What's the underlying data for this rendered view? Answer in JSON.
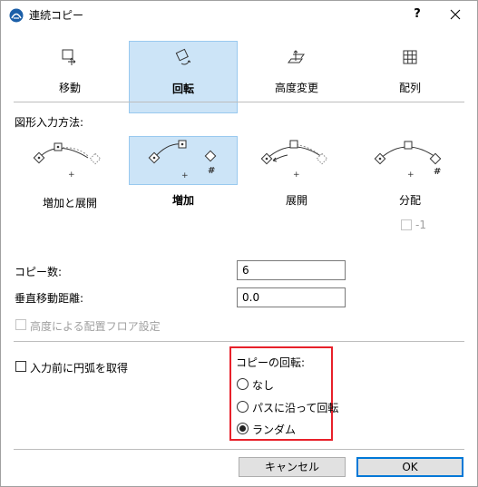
{
  "window": {
    "title": "連続コピー",
    "help": "?"
  },
  "modes": [
    {
      "label": "移動",
      "icon": "move-icon"
    },
    {
      "label": "回転",
      "icon": "rotate-icon",
      "selected": true
    },
    {
      "label": "高度変更",
      "icon": "elevate-icon"
    },
    {
      "label": "配列",
      "icon": "matrix-icon"
    }
  ],
  "input_method": {
    "heading": "図形入力方法:",
    "options": [
      {
        "label": "増加と展開",
        "icon": "increment-and-spread-icon"
      },
      {
        "label": "増加",
        "icon": "increment-icon",
        "selected": true,
        "marker": "#"
      },
      {
        "label": "展開",
        "icon": "spread-icon"
      },
      {
        "label": "分配",
        "icon": "distribute-icon",
        "marker": "#"
      }
    ],
    "minus_one": {
      "label": "-1",
      "checked": false,
      "disabled": true
    }
  },
  "fields": {
    "copies": {
      "label": "コピー数:",
      "value": "6"
    },
    "vertical": {
      "label": "垂直移動距離:",
      "value": "0.0"
    }
  },
  "floor_setting": {
    "label": "高度による配置フロア設定",
    "checked": false,
    "disabled": true
  },
  "arc_option": {
    "label": "入力前に円弧を取得",
    "checked": false
  },
  "copy_rotation": {
    "heading": "コピーの回転:",
    "options": [
      {
        "label": "なし",
        "selected": false
      },
      {
        "label": "パスに沿って回転",
        "selected": false
      },
      {
        "label": "ランダム",
        "selected": true
      }
    ]
  },
  "buttons": {
    "cancel": "キャンセル",
    "ok": "OK"
  },
  "colors": {
    "selection_bg": "#cce4f7",
    "highlight": "#e8202a",
    "primary_border": "#0078d7"
  }
}
